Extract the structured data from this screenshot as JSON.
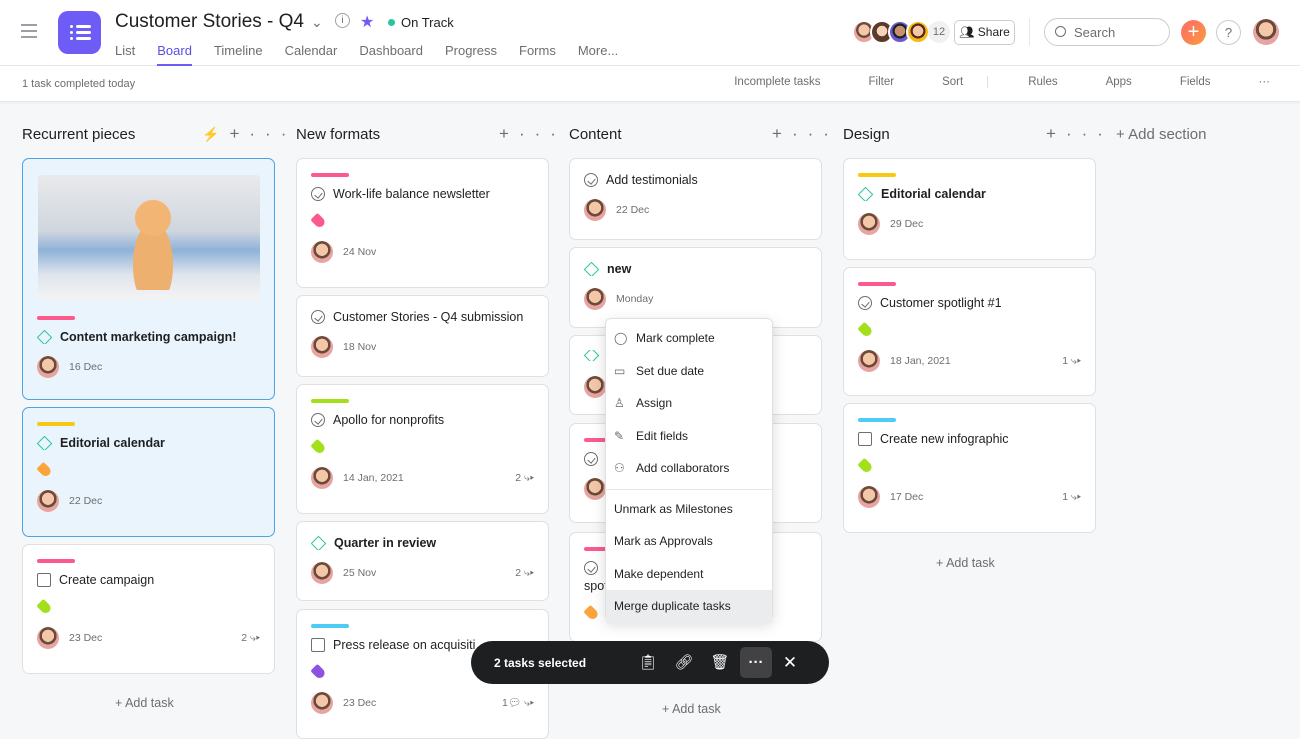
{
  "header": {
    "title": "Customer Stories - Q4",
    "status": "On Track",
    "member_count": "12",
    "share_label": "Share",
    "search_placeholder": "Search",
    "help": "?",
    "tabs": [
      "List",
      "Board",
      "Timeline",
      "Calendar",
      "Dashboard",
      "Progress",
      "Forms",
      "More..."
    ],
    "active_tab": "Board"
  },
  "toolbar": {
    "summary": "1 task completed today",
    "items": [
      "Incomplete tasks",
      "Filter",
      "Sort",
      "Rules",
      "Apps",
      "Fields",
      "···"
    ]
  },
  "add_section": "+ Add section",
  "add_task": "+ Add task",
  "colors": {
    "accent": "#6d5cf6",
    "pink": "#fc5a8d",
    "yellow": "#f8c913",
    "green": "#a3e01b",
    "cyan": "#4ecbf4",
    "orange": "#fca43b",
    "purple": "#8d52e0",
    "milestone": "#2ac3a2"
  },
  "columns": [
    {
      "name": "Recurrent pieces",
      "has_rule": true,
      "cards": [
        {
          "image": "kitten-on-laptop",
          "bar": "#fc5a8d",
          "icon": "milestone",
          "title": "Content marketing campaign!",
          "bold": true,
          "date": "16 Dec",
          "selected": true
        },
        {
          "bar": "#f8c913",
          "icon": "milestone",
          "title": "Editorial calendar",
          "bold": true,
          "tag": "#fca43b",
          "date": "22 Dec",
          "selected": true
        },
        {
          "bar": "#fc5a8d",
          "icon": "approval",
          "title": "Create campaign",
          "tag": "#a3e01b",
          "date": "23 Dec",
          "subtasks": "2"
        }
      ]
    },
    {
      "name": "New formats",
      "cards": [
        {
          "bar": "#fc5a8d",
          "icon": "check",
          "title": "Work-life balance newsletter",
          "tag": "#fc5a8d",
          "date": "24 Nov"
        },
        {
          "icon": "check",
          "title": "Customer Stories - Q4 submission",
          "date": "18 Nov"
        },
        {
          "bar": "#a3e01b",
          "icon": "check",
          "title": "Apollo for nonprofits",
          "tag": "#a3e01b",
          "date": "14 Jan, 2021",
          "subtasks": "2"
        },
        {
          "icon": "milestone",
          "title": "Quarter in review",
          "bold": true,
          "date": "25 Nov",
          "subtasks": "2"
        },
        {
          "bar": "#4ecbf4",
          "icon": "dependency",
          "title": "Press release on acquisiti",
          "tag": "#8d52e0",
          "date": "23 Dec",
          "comments": "1"
        }
      ]
    },
    {
      "name": "Content",
      "cards": [
        {
          "icon": "check",
          "title": "Add testimonials",
          "date": "22 Dec"
        },
        {
          "icon": "milestone",
          "title": "new",
          "bold": true,
          "date": "Monday"
        },
        {
          "icon": "milestone",
          "title": "",
          "date": ""
        },
        {
          "bar": "#fc5a8d",
          "icon": "check",
          "title": "",
          "date": ""
        },
        {
          "bar": "#fc5a8d",
          "icon": "check",
          "title": "y",
          "title2": "spot",
          "tag": "#fca43b"
        }
      ]
    },
    {
      "name": "Design",
      "cards": [
        {
          "bar": "#f8c913",
          "icon": "milestone",
          "title": "Editorial calendar",
          "bold": true,
          "date": "29 Dec"
        },
        {
          "bar": "#fc5a8d",
          "icon": "check",
          "title": "Customer spotlight #1",
          "tag": "#a3e01b",
          "date": "18 Jan, 2021",
          "subtasks": "1"
        },
        {
          "bar": "#4ecbf4",
          "icon": "approval",
          "title": "Create new infographic",
          "tag": "#a3e01b",
          "date": "17 Dec",
          "subtasks": "1"
        }
      ]
    }
  ],
  "context_menu": {
    "items": [
      {
        "label": "Mark complete",
        "icon": "check-circle-icon"
      },
      {
        "label": "Set due date",
        "icon": "calendar-icon"
      },
      {
        "label": "Assign",
        "icon": "person-icon"
      },
      {
        "label": "Edit fields",
        "icon": "pencil-icon"
      },
      {
        "label": "Add collaborators",
        "icon": "people-add-icon"
      }
    ],
    "items2": [
      "Unmark as Milestones",
      "Mark as Approvals",
      "Make dependent",
      "Merge duplicate tasks"
    ],
    "highlighted": "Merge duplicate tasks"
  },
  "selection_bar": {
    "label": "2 tasks selected"
  }
}
